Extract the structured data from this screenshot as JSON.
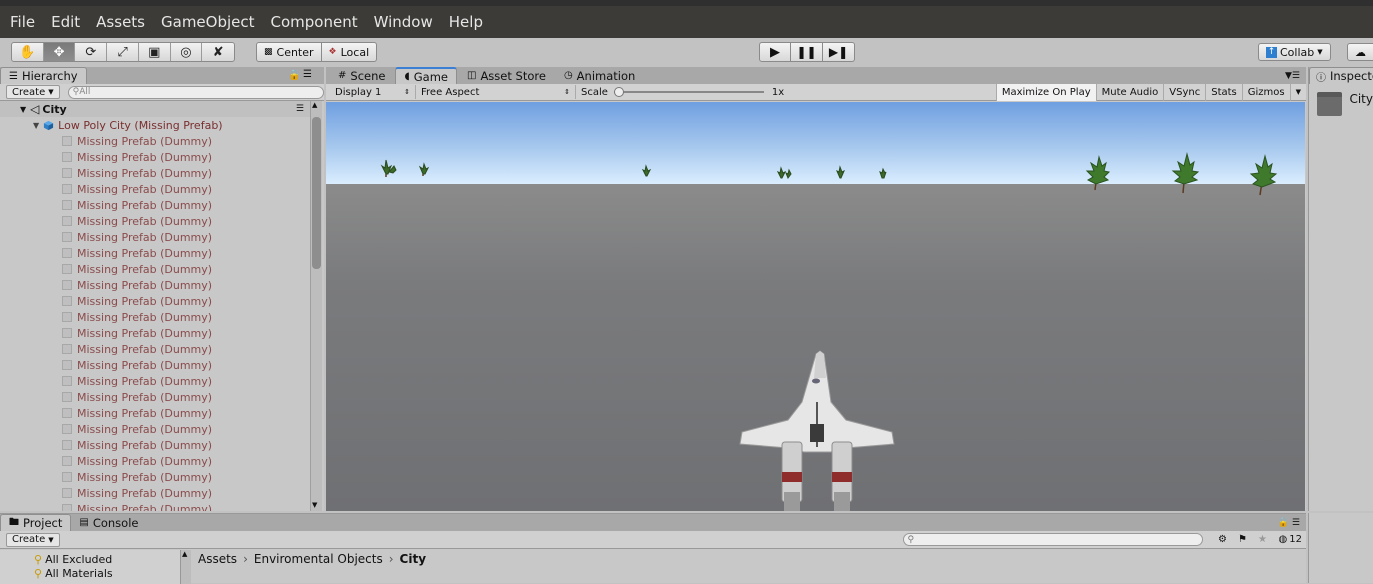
{
  "menu": [
    "File",
    "Edit",
    "Assets",
    "GameObject",
    "Component",
    "Window",
    "Help"
  ],
  "toolbar": {
    "tools": [
      "hand-icon",
      "move-icon",
      "rotate-icon",
      "scale-icon",
      "rect-icon",
      "transform-icon",
      "custom-tool-icon"
    ],
    "pivot_label": "Center",
    "space_label": "Local",
    "collab_label": "Collab"
  },
  "hierarchy": {
    "tab": "Hierarchy",
    "create_label": "Create",
    "search_placeholder": "All",
    "scene_name": "City",
    "root_object": "Low Poly City (Missing Prefab)",
    "children": [
      "Missing Prefab (Dummy)",
      "Missing Prefab (Dummy)",
      "Missing Prefab (Dummy)",
      "Missing Prefab (Dummy)",
      "Missing Prefab (Dummy)",
      "Missing Prefab (Dummy)",
      "Missing Prefab (Dummy)",
      "Missing Prefab (Dummy)",
      "Missing Prefab (Dummy)",
      "Missing Prefab (Dummy)",
      "Missing Prefab (Dummy)",
      "Missing Prefab (Dummy)",
      "Missing Prefab (Dummy)",
      "Missing Prefab (Dummy)",
      "Missing Prefab (Dummy)",
      "Missing Prefab (Dummy)",
      "Missing Prefab (Dummy)",
      "Missing Prefab (Dummy)",
      "Missing Prefab (Dummy)",
      "Missing Prefab (Dummy)",
      "Missing Prefab (Dummy)",
      "Missing Prefab (Dummy)",
      "Missing Prefab (Dummy)",
      "Missing Prefab (Dummy)"
    ]
  },
  "center_tabs": {
    "scene": "Scene",
    "game": "Game",
    "asset_store": "Asset Store",
    "animation": "Animation"
  },
  "game_bar": {
    "display": "Display 1",
    "aspect": "Free Aspect",
    "scale_label": "Scale",
    "scale_value": "1x",
    "maximize": "Maximize On Play",
    "mute": "Mute Audio",
    "vsync": "VSync",
    "stats": "Stats",
    "gizmos": "Gizmos"
  },
  "inspector": {
    "tab": "Inspector",
    "object_name": "City"
  },
  "project": {
    "tab": "Project",
    "console_tab": "Console",
    "create_label": "Create",
    "filter_count": "12",
    "favorites": [
      "All Excluded",
      "All Materials"
    ],
    "breadcrumb": [
      "Assets",
      "Enviromental Objects",
      "City"
    ]
  }
}
